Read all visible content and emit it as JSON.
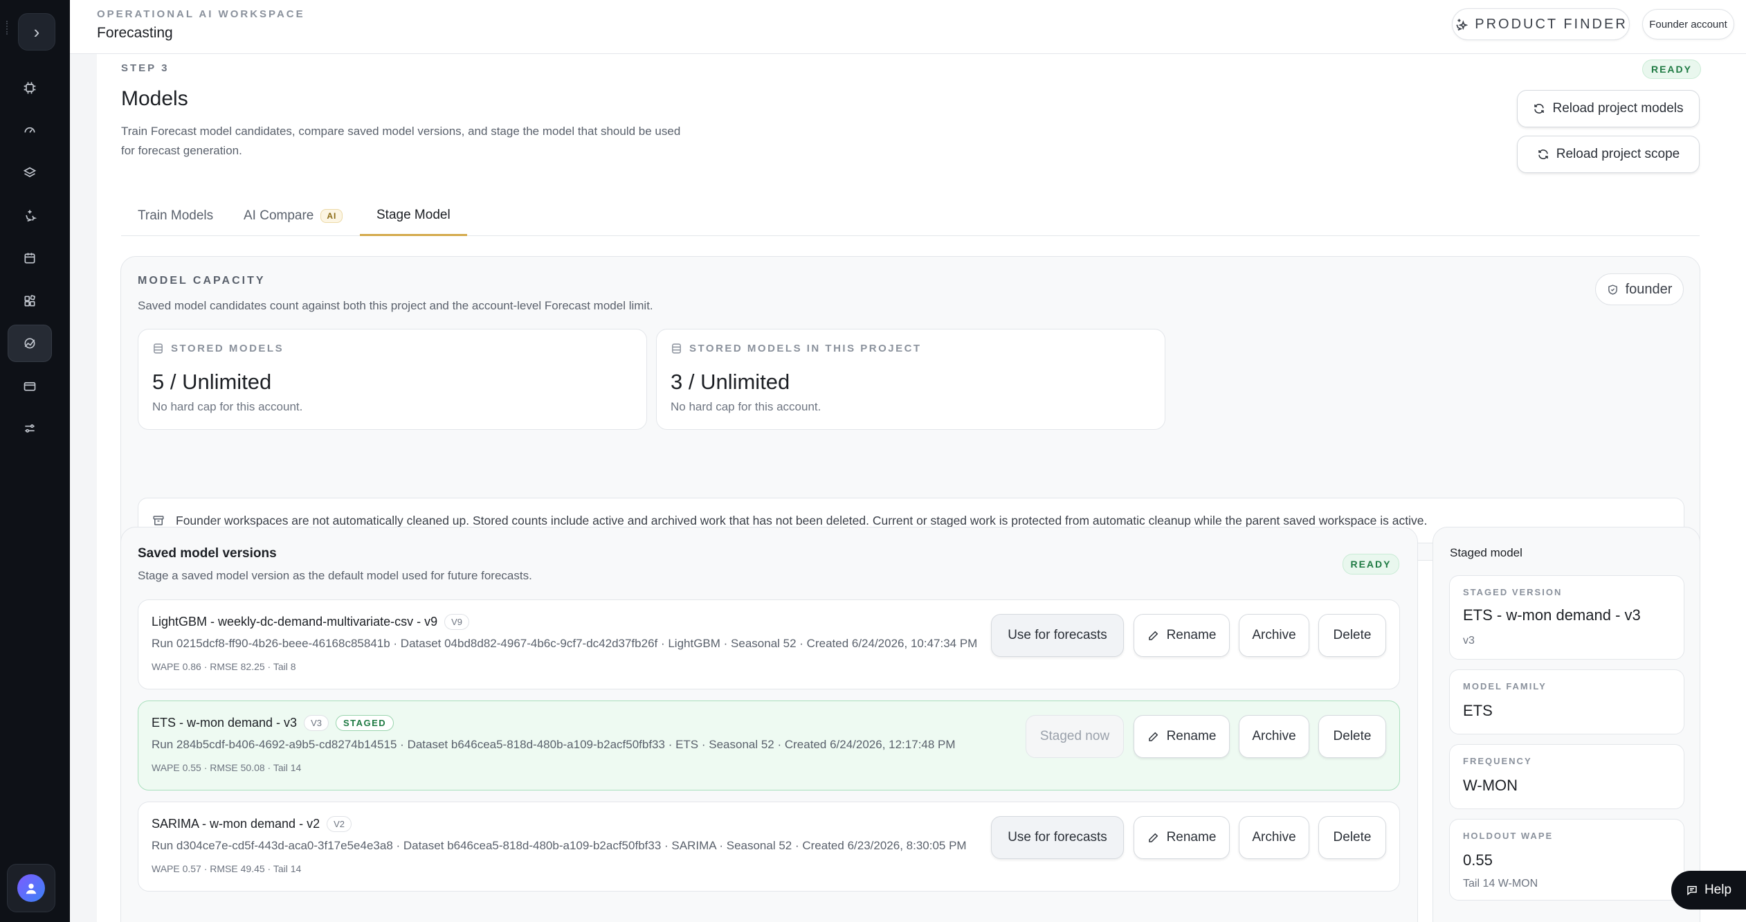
{
  "header": {
    "kicker": "OPERATIONAL AI WORKSPACE",
    "title": "Forecasting",
    "product_finder": "PRODUCT FINDER",
    "account": "Founder account"
  },
  "sidebar": {
    "items": [
      {
        "icon": "cpu-icon"
      },
      {
        "icon": "gauge-icon"
      },
      {
        "icon": "layers-icon"
      },
      {
        "icon": "sparkles-icon"
      },
      {
        "icon": "calendar-icon"
      },
      {
        "icon": "blocks-icon"
      },
      {
        "icon": "forecast-icon",
        "active": true
      },
      {
        "icon": "card-icon"
      },
      {
        "icon": "sliders-icon"
      }
    ]
  },
  "step": {
    "label": "STEP 3",
    "status": "READY",
    "title": "Models",
    "description": "Train Forecast model candidates, compare saved model versions, and stage the model that should be used for forecast generation.",
    "reload_models": "Reload project models",
    "reload_scope": "Reload project scope"
  },
  "tabs": [
    {
      "label": "Train Models"
    },
    {
      "label": "AI Compare",
      "badge": "AI"
    },
    {
      "label": "Stage Model",
      "active": true
    }
  ],
  "capacity": {
    "title": "MODEL CAPACITY",
    "description": "Saved model candidates count against both this project and the account-level Forecast model limit.",
    "plan": "founder",
    "stats": [
      {
        "label": "STORED MODELS",
        "value": "5 / Unlimited",
        "sub": "No hard cap for this account."
      },
      {
        "label": "STORED MODELS IN THIS PROJECT",
        "value": "3 / Unlimited",
        "sub": "No hard cap for this account."
      }
    ],
    "notice": "Founder workspaces are not automatically cleaned up. Stored counts include active and archived work that has not been deleted. Current or staged work is protected from automatic cleanup while the parent saved workspace is active."
  },
  "versions": {
    "title": "Saved model versions",
    "description": "Stage a saved model version as the default model used for future forecasts.",
    "status": "READY",
    "rows": [
      {
        "name": "LightGBM - weekly-dc-demand-multivariate-csv - v9",
        "version": "V9",
        "meta": "Run 0215dcf8-ff90-4b26-beee-46168c85841b · Dataset 04bd8d82-4967-4b6c-9cf7-dc42d37fb26f · LightGBM · Seasonal 52 · Created 6/24/2026, 10:47:34 PM",
        "metrics": "WAPE 0.86 · RMSE 82.25 · Tail 8",
        "primary_action": "Use for forecasts"
      },
      {
        "name": "ETS - w-mon demand - v3",
        "version": "V3",
        "staged_label": "STAGED",
        "meta": "Run 284b5cdf-b406-4692-a9b5-cd8274b14515 · Dataset b646cea5-818d-480b-a109-b2acf50fbf33 · ETS · Seasonal 52 · Created 6/24/2026, 12:17:48 PM",
        "metrics": "WAPE 0.55 · RMSE 50.08 · Tail 14",
        "primary_action": "Staged now"
      },
      {
        "name": "SARIMA - w-mon demand - v2",
        "version": "V2",
        "meta": "Run d304ce7e-cd5f-443d-aca0-3f17e5e4e3a8 · Dataset b646cea5-818d-480b-a109-b2acf50fbf33 · SARIMA · Seasonal 52 · Created 6/23/2026, 8:30:05 PM",
        "metrics": "WAPE 0.57 · RMSE 49.45 · Tail 14",
        "primary_action": "Use for forecasts"
      }
    ],
    "rename": "Rename",
    "archive": "Archive",
    "delete": "Delete"
  },
  "staged": {
    "title": "Staged model",
    "version_label": "STAGED VERSION",
    "version_value": "ETS - w-mon demand - v3",
    "version_sub": "v3",
    "family_label": "MODEL FAMILY",
    "family_value": "ETS",
    "frequency_label": "FREQUENCY",
    "frequency_value": "W-MON",
    "wape_label": "HOLDOUT WAPE",
    "wape_value": "0.55",
    "wape_sub": "Tail 14 W-MON"
  },
  "help": "Help",
  "colors": {
    "sidebar": "#0e1117",
    "accent": "#d3a94a",
    "ready": "#1f7a43",
    "staged_bg": "#eefaf2"
  }
}
